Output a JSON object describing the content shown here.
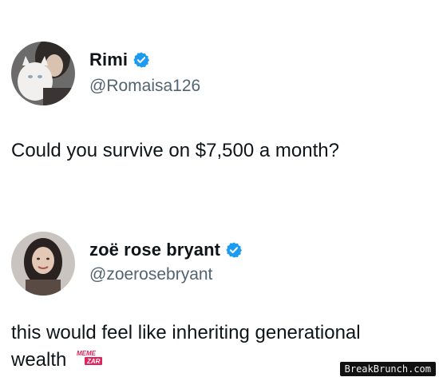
{
  "tweet1": {
    "name": "Rimi",
    "handle": "@Romaisa126",
    "text": "Could you survive on $7,500 a month?",
    "verified_color": "#1d9bf0"
  },
  "tweet2": {
    "name": "zoë rose bryant",
    "handle": "@zoerosebryant",
    "text_line1": "this would feel like inheriting generational",
    "text_line2": "wealth",
    "verified_color": "#1d9bf0"
  },
  "overlays": {
    "meme_logo_top": "MEME",
    "meme_logo_bottom": "ZAR",
    "watermark": "BreakBrunch.com"
  },
  "colors": {
    "text": "#0f1419",
    "secondary": "#536471",
    "accent": "#1d9bf0"
  }
}
